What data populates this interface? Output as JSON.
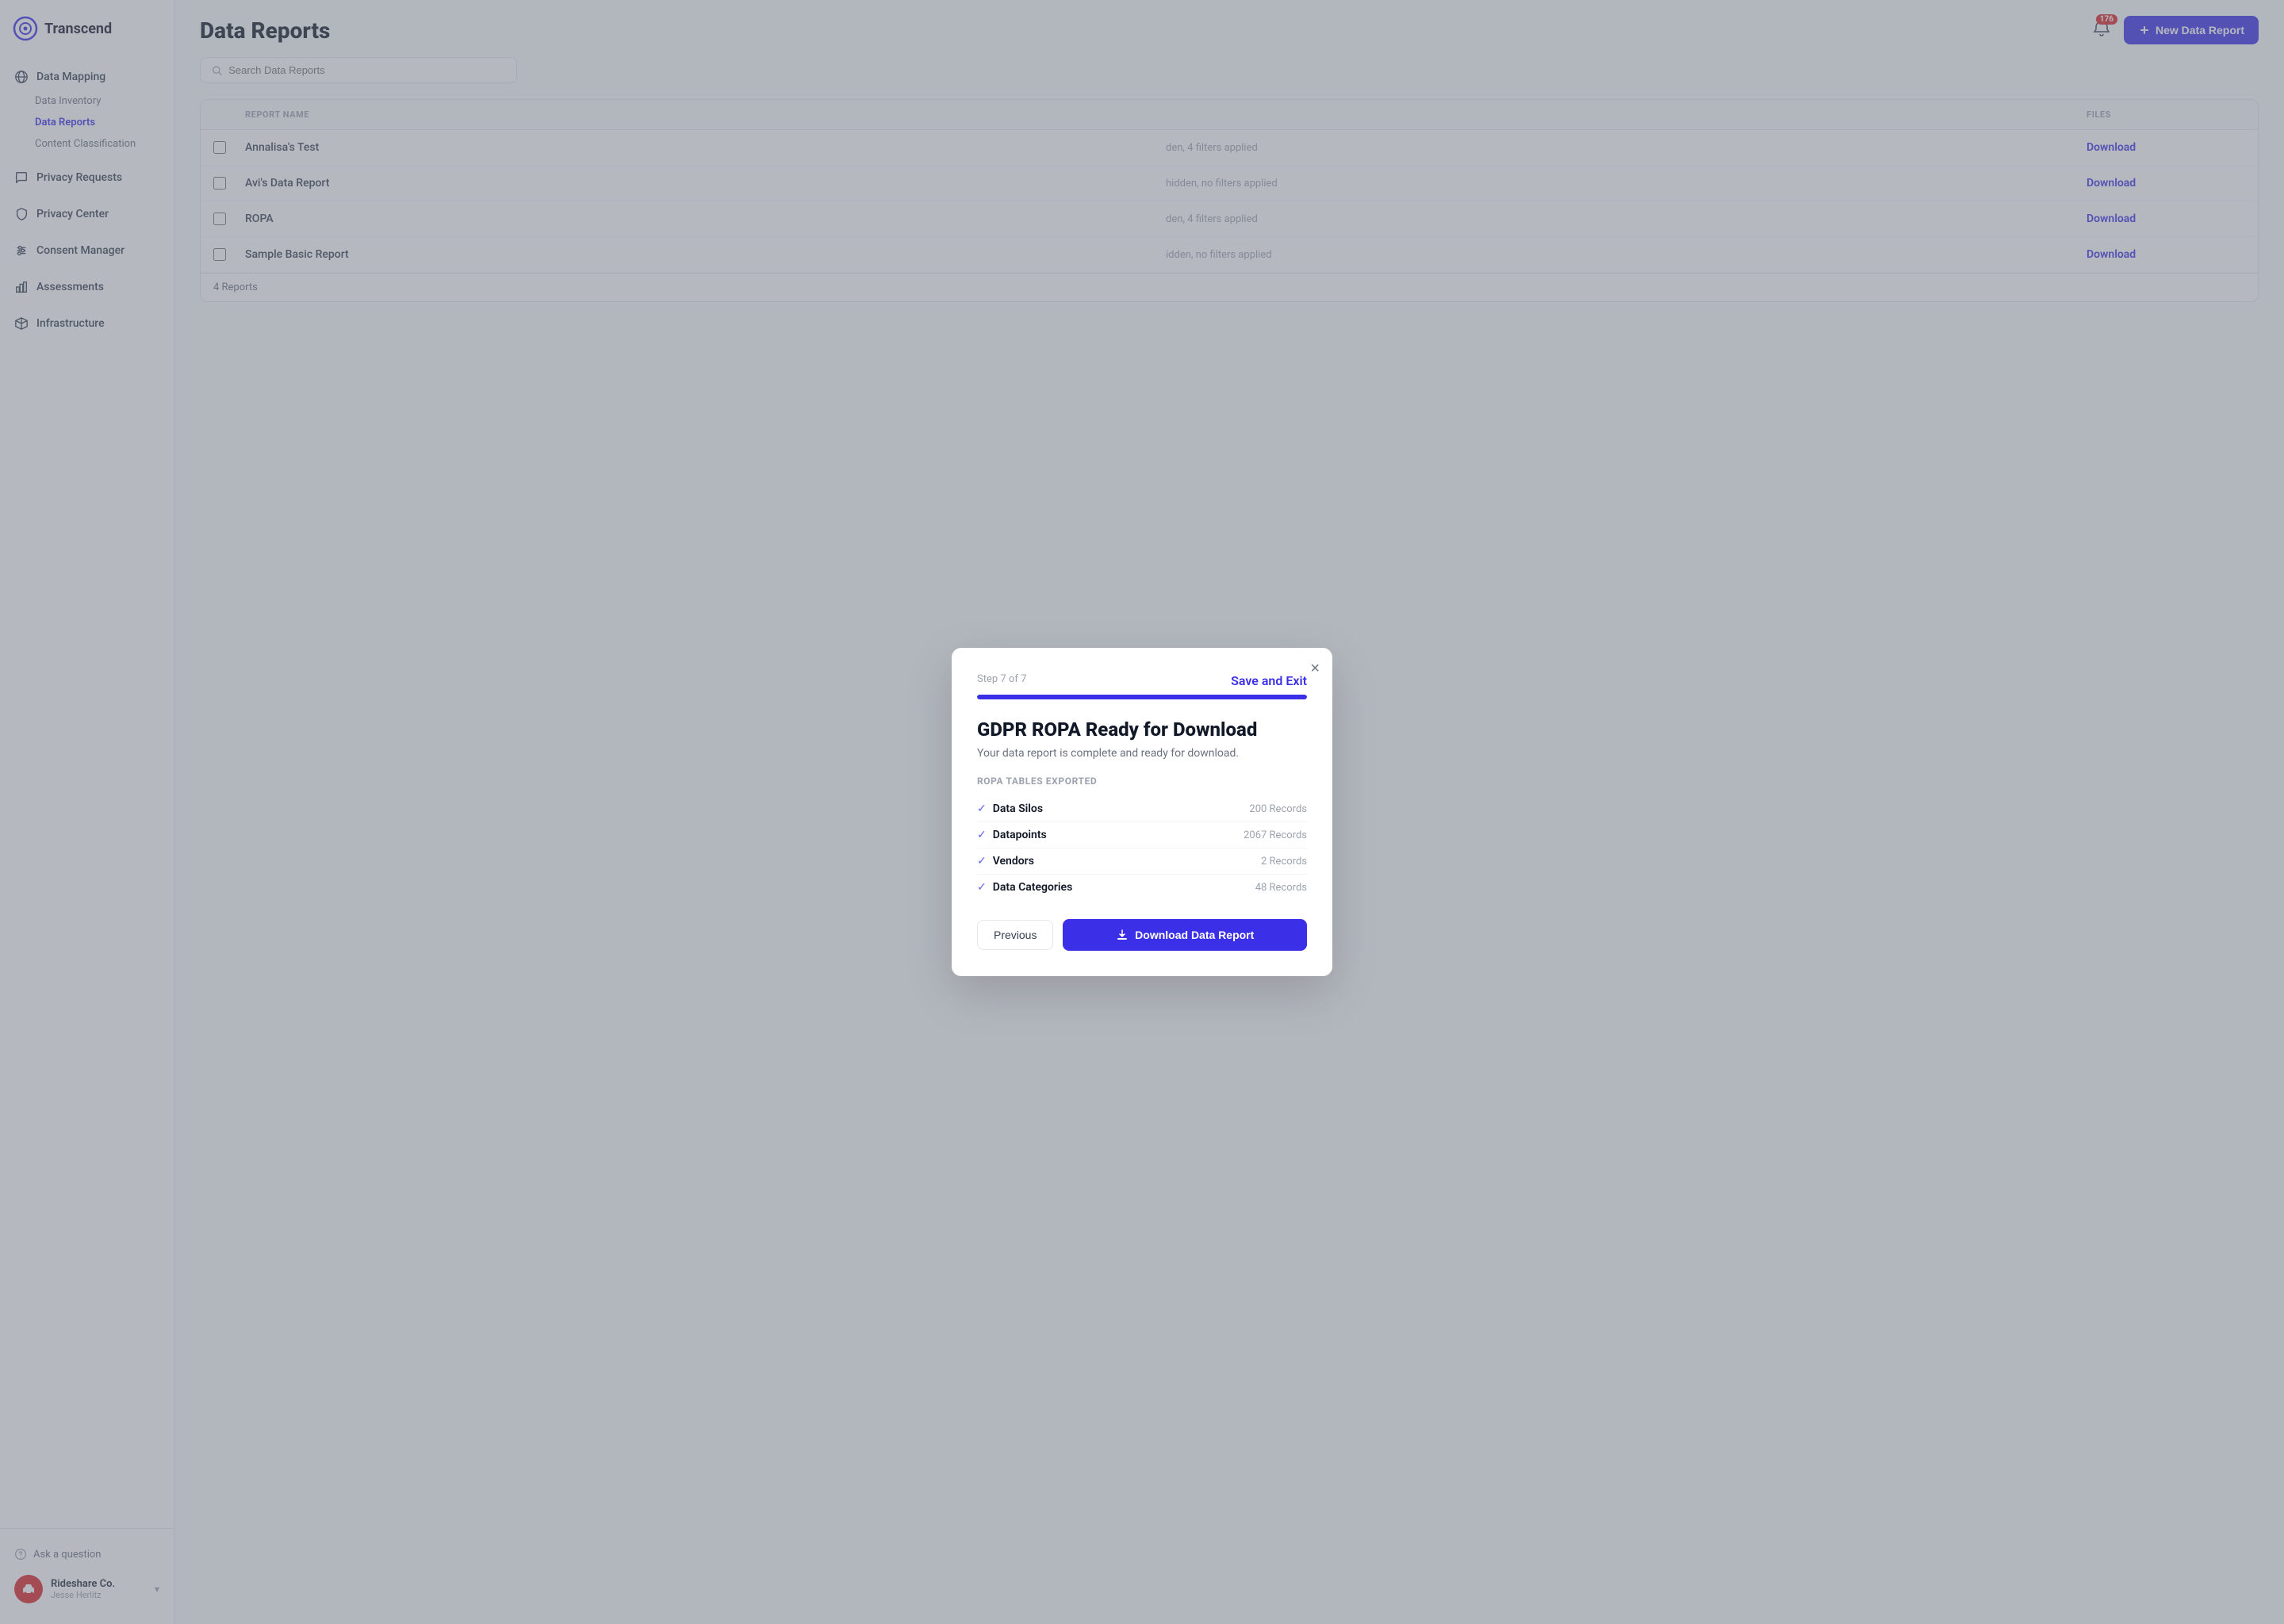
{
  "app": {
    "logo_text": "Transcend"
  },
  "sidebar": {
    "groups": [
      {
        "id": "data-mapping",
        "label": "Data Mapping",
        "icon": "globe-icon",
        "sub_items": [
          {
            "id": "data-inventory",
            "label": "Data Inventory",
            "active": false
          },
          {
            "id": "data-reports",
            "label": "Data Reports",
            "active": true
          },
          {
            "id": "content-classification",
            "label": "Content Classification",
            "active": false
          }
        ]
      },
      {
        "id": "privacy-requests",
        "label": "Privacy Requests",
        "icon": "chat-icon",
        "sub_items": []
      },
      {
        "id": "privacy-center",
        "label": "Privacy Center",
        "icon": "shield-icon",
        "sub_items": []
      },
      {
        "id": "consent-manager",
        "label": "Consent Manager",
        "icon": "sliders-icon",
        "sub_items": []
      },
      {
        "id": "assessments",
        "label": "Assessments",
        "icon": "chart-icon",
        "sub_items": []
      },
      {
        "id": "infrastructure",
        "label": "Infrastructure",
        "icon": "cube-icon",
        "sub_items": []
      }
    ],
    "bottom": {
      "ask_question_label": "Ask a question",
      "user_name": "Rideshare Co.",
      "user_email": "Jesse Herlitz"
    }
  },
  "header": {
    "page_title": "Data Reports",
    "notification_count": "176",
    "new_report_button": "New Data Report"
  },
  "search": {
    "placeholder": "Search Data Reports"
  },
  "table": {
    "columns": [
      "",
      "REPORT NAME",
      "",
      "FILES"
    ],
    "rows": [
      {
        "name": "Annalisa's Test",
        "filters": "den, 4 filters applied",
        "download": "Download"
      },
      {
        "name": "Avi's Data Report",
        "filters": "hidden, no filters applied",
        "download": "Download"
      },
      {
        "name": "ROPA",
        "filters": "den, 4 filters applied",
        "download": "Download"
      },
      {
        "name": "Sample Basic Report",
        "filters": "idden, no filters applied",
        "download": "Download"
      }
    ],
    "footer": "4 Reports"
  },
  "modal": {
    "step_label": "Step 7 of 7",
    "save_exit_label": "Save and Exit",
    "progress_percent": 100,
    "close_label": "×",
    "title": "GDPR ROPA Ready for Download",
    "description": "Your data report is complete and ready for download.",
    "ropa_section_label": "ROPA Tables Exported",
    "ropa_items": [
      {
        "name": "Data Silos",
        "records": "200 Records"
      },
      {
        "name": "Datapoints",
        "records": "2067 Records"
      },
      {
        "name": "Vendors",
        "records": "2 Records"
      },
      {
        "name": "Data Categories",
        "records": "48 Records"
      }
    ],
    "previous_button": "Previous",
    "download_button": "Download Data Report"
  },
  "colors": {
    "brand": "#3b30e8",
    "danger": "#dc2626"
  }
}
